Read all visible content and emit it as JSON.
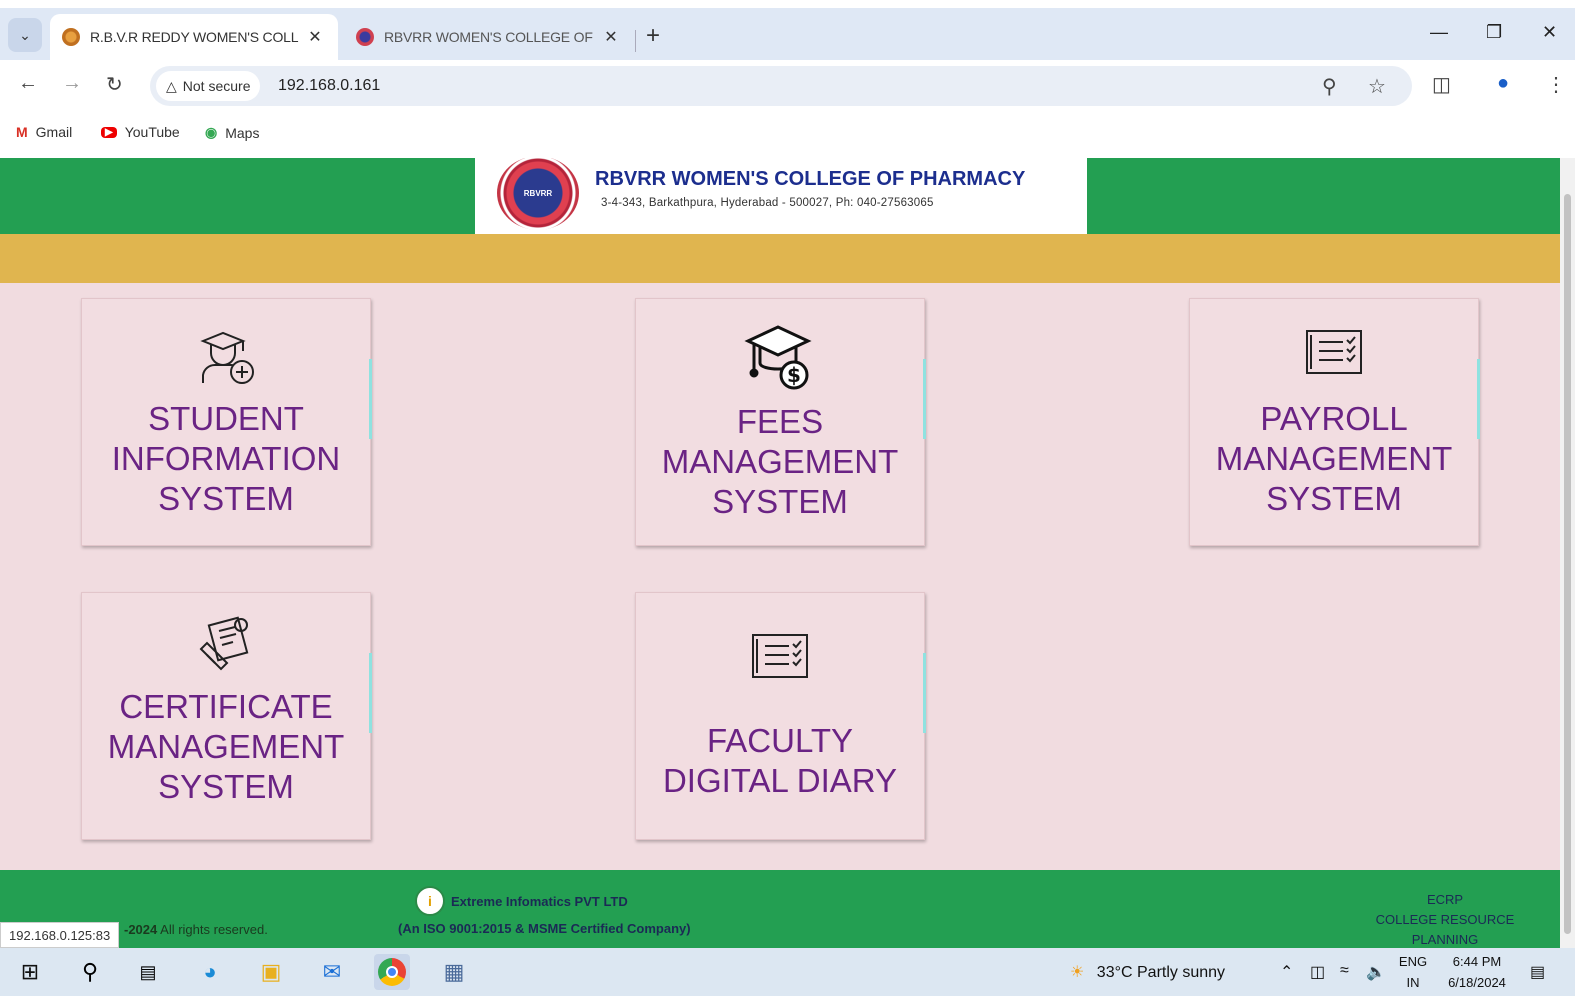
{
  "browser": {
    "tabs": [
      {
        "title": "R.B.V.R REDDY WOMEN'S COLL",
        "active": true
      },
      {
        "title": "RBVRR WOMEN'S COLLEGE OF",
        "active": false
      }
    ],
    "security_label": "Not secure",
    "url": "192.168.0.161",
    "bookmarks": [
      "Gmail",
      "YouTube",
      "Maps"
    ]
  },
  "header": {
    "title": "RBVRR WOMEN'S COLLEGE OF PHARMACY",
    "address": "3-4-343, Barkathpura, Hyderabad - 500027, Ph: 040-27563065",
    "logo_text": "RBVRR"
  },
  "modules": [
    {
      "lines": [
        "STUDENT",
        "INFORMATION",
        "SYSTEM"
      ],
      "icon": "student-icon"
    },
    {
      "lines": [
        "FEES",
        "MANAGEMENT",
        "SYSTEM"
      ],
      "icon": "graduation-cap-dollar-icon"
    },
    {
      "lines": [
        "PAYROLL",
        "MANAGEMENT",
        "SYSTEM"
      ],
      "icon": "checklist-icon"
    },
    {
      "lines": [
        "CERTIFICATE",
        "MANAGEMENT",
        "SYSTEM"
      ],
      "icon": "certificate-icon"
    },
    {
      "lines": [
        "FACULTY",
        "DIGITAL DIARY"
      ],
      "icon": "checklist-icon"
    }
  ],
  "footer": {
    "copyright_year": "-2024",
    "copyright_text": "All rights reserved.",
    "company": "Extreme Infomatics PVT LTD",
    "certification": "(An ISO 9001:2015 & MSME Certified Company)",
    "product_short": "ECRP",
    "product_long": "COLLEGE RESOURCE PLANNING"
  },
  "status_url": "192.168.0.125:83",
  "taskbar": {
    "weather": "33°C  Partly sunny",
    "lang_top": "ENG",
    "lang_bottom": "IN",
    "time": "6:44 PM",
    "date": "6/18/2024"
  },
  "colors": {
    "header_green": "#239f52",
    "gold_band": "#e0b54f",
    "page_bg": "#f1dce0",
    "module_text": "#6a2384",
    "brand_blue": "#1c2e8e"
  }
}
